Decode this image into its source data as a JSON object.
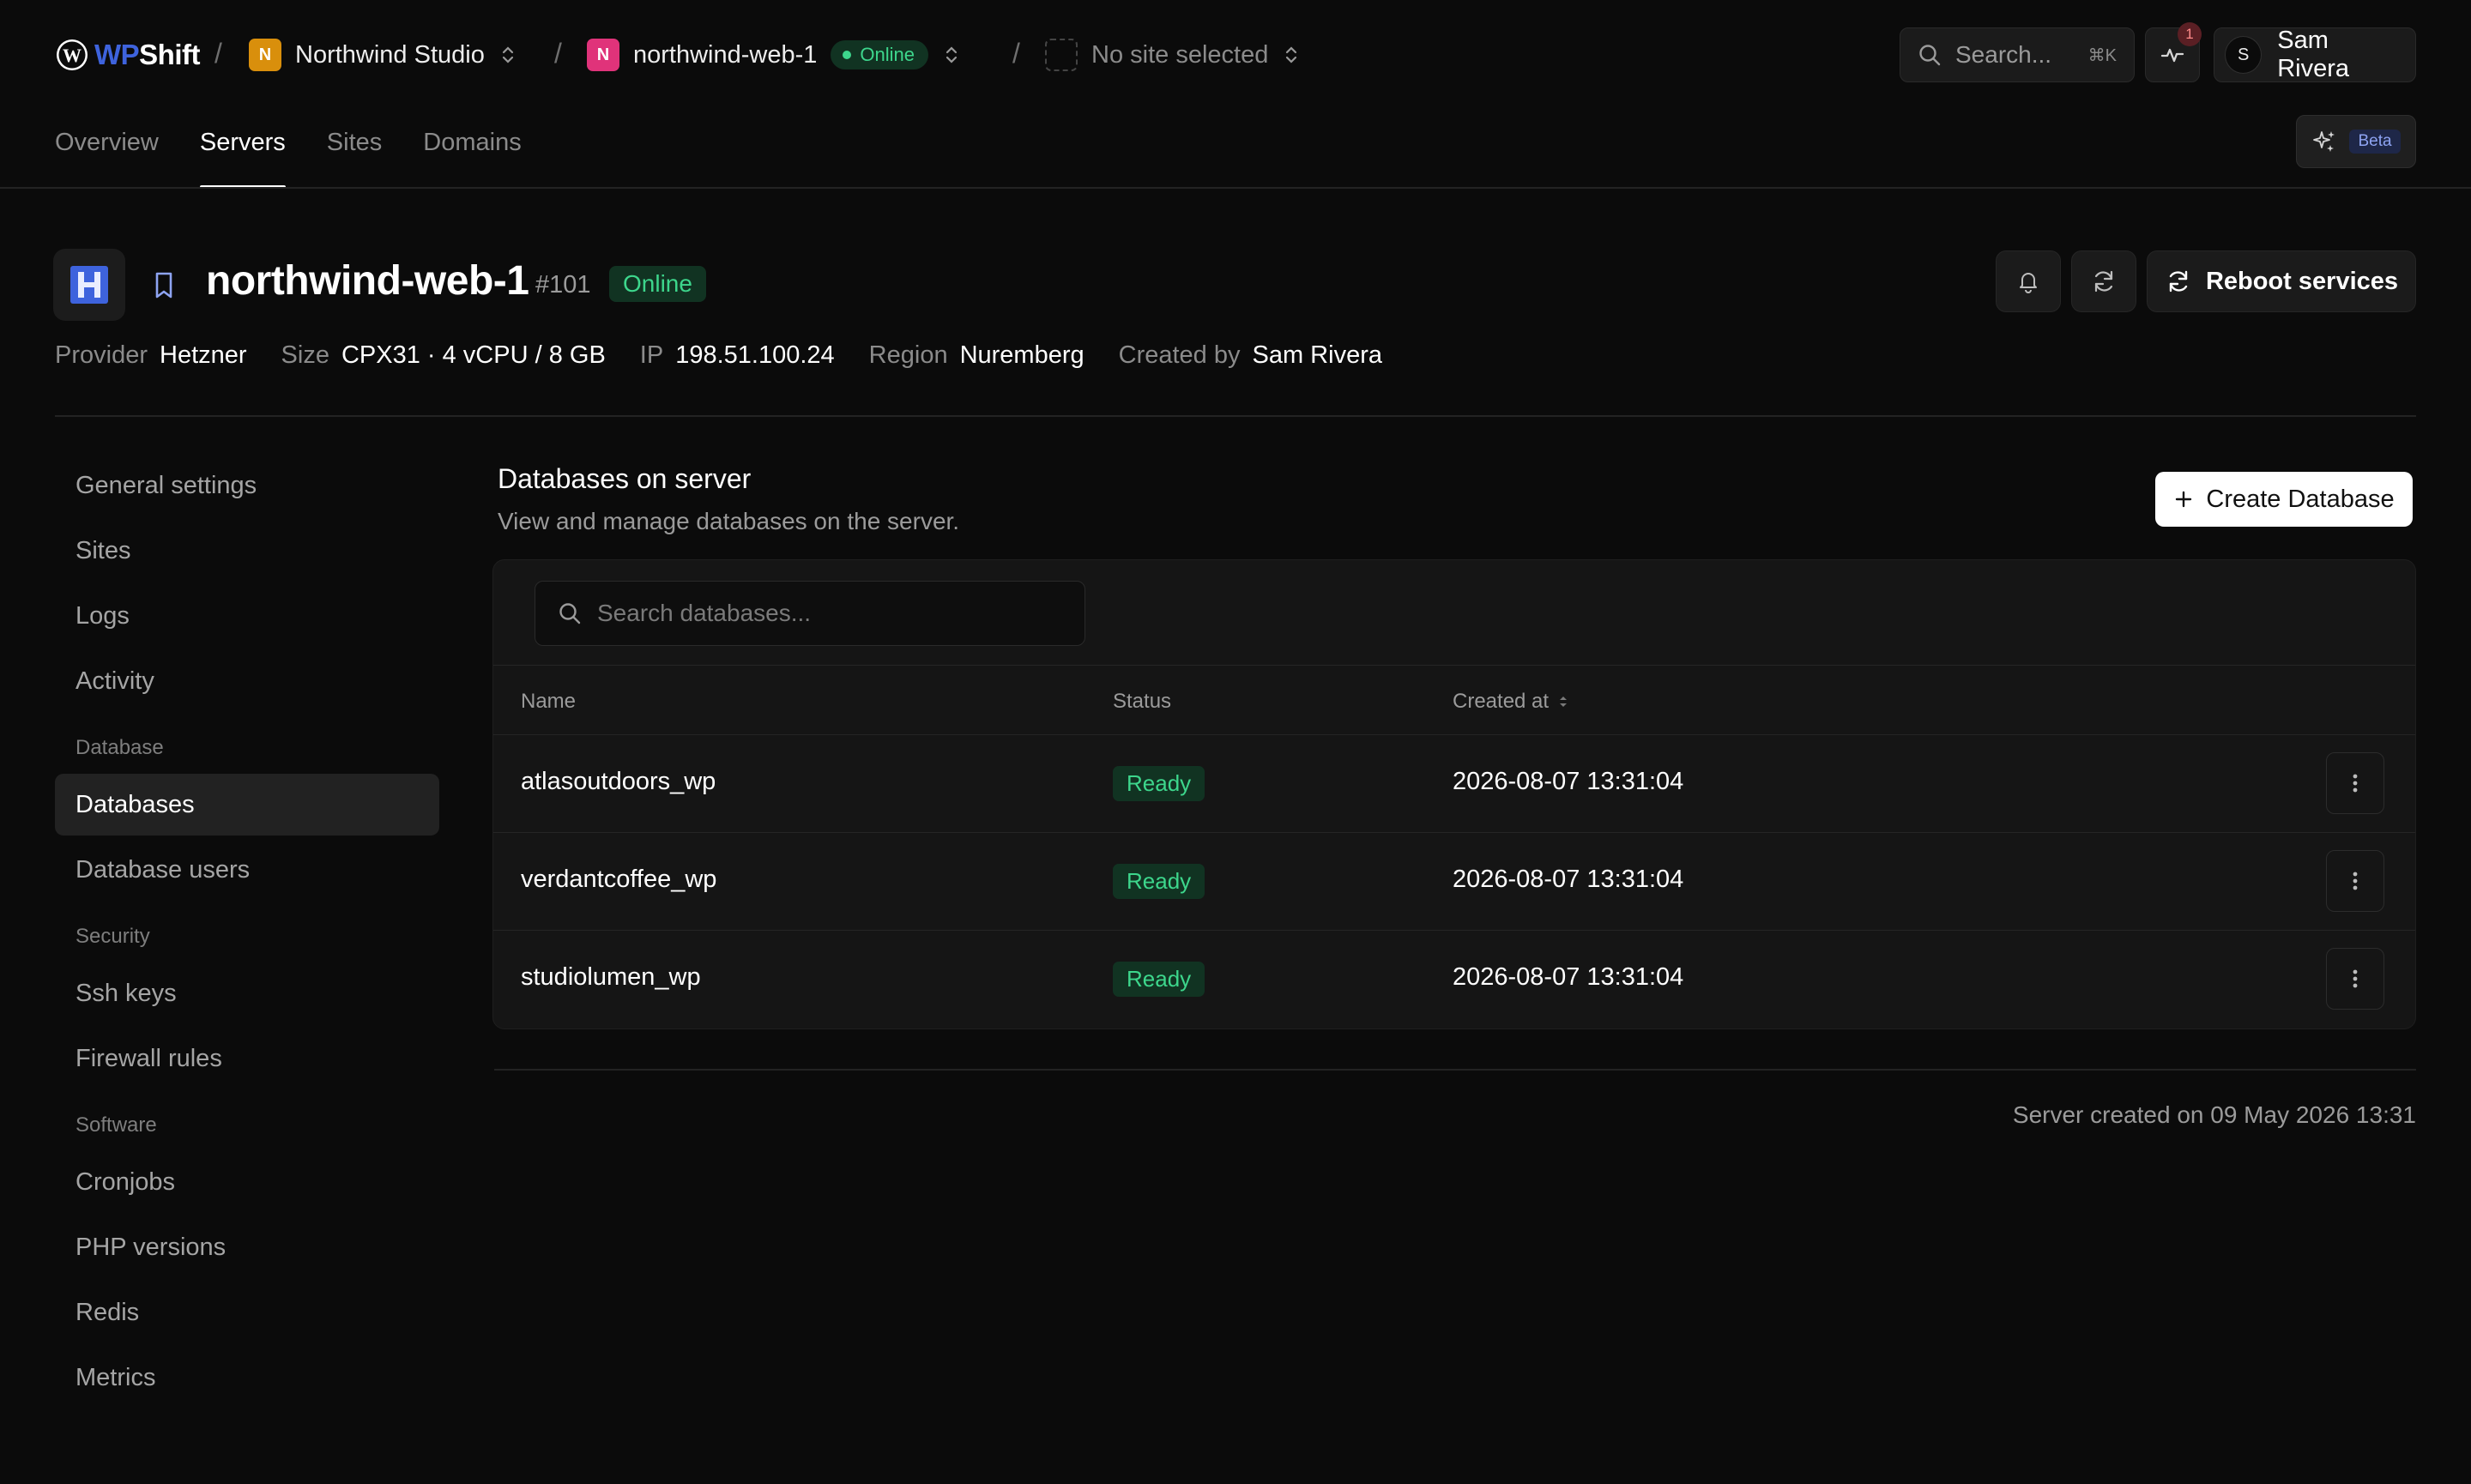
{
  "brand": {
    "name_a": "WP",
    "name_b": "Shift"
  },
  "breadcrumb": {
    "org": {
      "initial": "N",
      "label": "Northwind Studio",
      "color": "#d98f0c"
    },
    "server": {
      "initial": "N",
      "label": "northwind-web-1",
      "status": "Online",
      "color": "#e0337a"
    },
    "site": {
      "label": "No site selected"
    }
  },
  "topbar": {
    "search_label": "Search...",
    "search_shortcut": "⌘K",
    "notifications_count": "1",
    "user": {
      "initial": "S",
      "name": "Sam Rivera"
    }
  },
  "nav": {
    "tabs": [
      {
        "label": "Overview",
        "active": false
      },
      {
        "label": "Servers",
        "active": true
      },
      {
        "label": "Sites",
        "active": false
      },
      {
        "label": "Domains",
        "active": false
      }
    ],
    "beta_label": "Beta"
  },
  "server": {
    "name": "northwind-web-1",
    "id": "#101",
    "status": "Online",
    "reboot_label": "Reboot services",
    "meta": [
      {
        "key": "Provider",
        "value": "Hetzner"
      },
      {
        "key": "Size",
        "value": "CPX31 · 4 vCPU / 8 GB"
      },
      {
        "key": "IP",
        "value": "198.51.100.24"
      },
      {
        "key": "Region",
        "value": "Nuremberg"
      },
      {
        "key": "Created by",
        "value": "Sam Rivera"
      }
    ]
  },
  "sidebar": {
    "items_top": [
      "General settings",
      "Sites",
      "Logs",
      "Activity"
    ],
    "groups": [
      {
        "title": "Database",
        "items": [
          "Databases",
          "Database users"
        ]
      },
      {
        "title": "Security",
        "items": [
          "Ssh keys",
          "Firewall rules"
        ]
      },
      {
        "title": "Software",
        "items": [
          "Cronjobs",
          "PHP versions",
          "Redis",
          "Metrics"
        ]
      }
    ],
    "active": "Databases"
  },
  "databases": {
    "title": "Databases on server",
    "subtitle": "View and manage databases on the server.",
    "create_label": "Create Database",
    "search_placeholder": "Search databases...",
    "columns": {
      "name": "Name",
      "status": "Status",
      "created": "Created at"
    },
    "rows": [
      {
        "name": "atlasoutdoors_wp",
        "status": "Ready",
        "created": "2026-08-07 13:31:04"
      },
      {
        "name": "verdantcoffee_wp",
        "status": "Ready",
        "created": "2026-08-07 13:31:04"
      },
      {
        "name": "studiolumen_wp",
        "status": "Ready",
        "created": "2026-08-07 13:31:04"
      }
    ]
  },
  "footer": {
    "created_text": "Server created on 09 May 2026 13:31"
  }
}
